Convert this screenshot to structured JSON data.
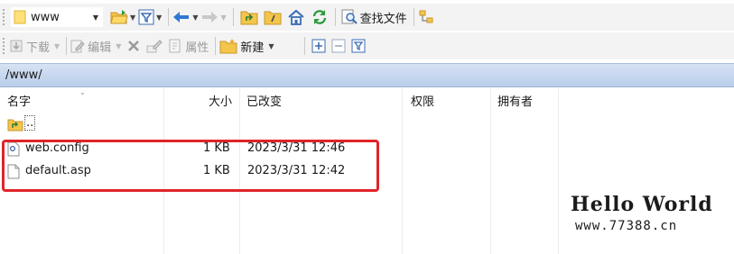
{
  "toolbar1": {
    "location": "www",
    "find_label": "查找文件"
  },
  "toolbar2": {
    "download_label": "下载",
    "edit_label": "编辑",
    "properties_label": "属性",
    "new_label": "新建"
  },
  "path": "/www/",
  "columns": {
    "name": "名字",
    "size": "大小",
    "modified": "已改变",
    "permissions": "权限",
    "owner": "拥有者"
  },
  "parent_entry": "..",
  "files": [
    {
      "name": "web.config",
      "size": "1 KB",
      "modified": "2023/3/31 12:46",
      "icon": "config-file-icon"
    },
    {
      "name": "default.asp",
      "size": "1 KB",
      "modified": "2023/3/31 12:42",
      "icon": "blank-file-icon"
    }
  ],
  "watermark": {
    "title": "Hello World",
    "url": "www.77388.cn"
  },
  "colors": {
    "highlight": "#e0242a",
    "path_bar": "#c5d6ee"
  }
}
